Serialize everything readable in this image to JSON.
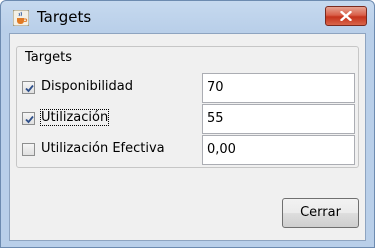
{
  "window": {
    "title": "Targets",
    "app_icon": "java-cup-icon",
    "close_icon": "close-icon"
  },
  "group": {
    "label": "Targets"
  },
  "rows": [
    {
      "label": "Disponibilidad",
      "checked": true,
      "value": "70"
    },
    {
      "label": "Utilización",
      "checked": true,
      "value": "55"
    },
    {
      "label": "Utilización Efectiva",
      "checked": false,
      "value": "0,00"
    }
  ],
  "buttons": {
    "close_label": "Cerrar"
  },
  "colors": {
    "title_bar": "#b9cfe9",
    "close_button": "#c5331c",
    "panel": "#f0f0f0"
  }
}
